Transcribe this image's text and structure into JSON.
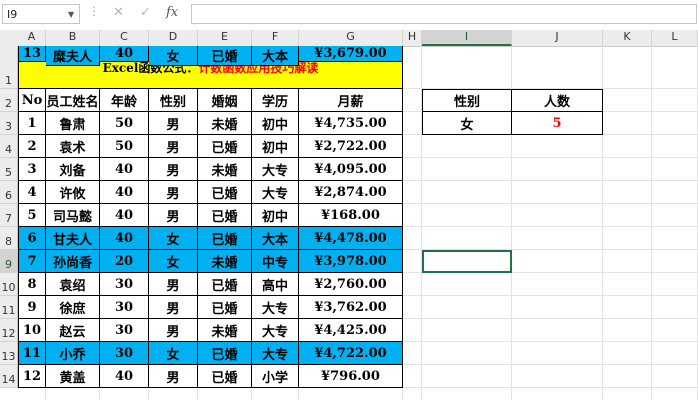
{
  "formula_bar": {
    "name_box": "I9",
    "icons": [
      "close-icon",
      "check-icon",
      "fx-icon"
    ],
    "fx_label": "fx",
    "formula": ""
  },
  "columns": [
    "A",
    "B",
    "C",
    "D",
    "E",
    "F",
    "G",
    "H",
    "I",
    "J",
    "K",
    "L"
  ],
  "rows": [
    "1",
    "2",
    "3",
    "4",
    "5",
    "6",
    "7",
    "8",
    "9",
    "10",
    "11",
    "12",
    "13",
    "14"
  ],
  "selected_cell": {
    "column": "I",
    "row": "9"
  },
  "sheet": {
    "title_part1": "Excel函数公式：",
    "title_part2": "计数函数应用技巧解读",
    "title_color_1": "#000000",
    "title_color_2": "#ff0000",
    "title_fill": "#ffff00",
    "highlight_fill": "#00b0f0",
    "headers": [
      "No",
      "员工姓名",
      "年龄",
      "性别",
      "婚姻",
      "学历",
      "月薪"
    ],
    "records": [
      {
        "no": "1",
        "name": "鲁肃",
        "age": "50",
        "gender": "男",
        "marital": "未婚",
        "edu": "初中",
        "salary": "¥4,735.00",
        "highlight": false
      },
      {
        "no": "2",
        "name": "袁术",
        "age": "50",
        "gender": "男",
        "marital": "已婚",
        "edu": "初中",
        "salary": "¥2,722.00",
        "highlight": false
      },
      {
        "no": "3",
        "name": "刘备",
        "age": "40",
        "gender": "男",
        "marital": "未婚",
        "edu": "大专",
        "salary": "¥4,095.00",
        "highlight": false
      },
      {
        "no": "4",
        "name": "许攸",
        "age": "40",
        "gender": "男",
        "marital": "已婚",
        "edu": "大专",
        "salary": "¥2,874.00",
        "highlight": false
      },
      {
        "no": "5",
        "name": "司马懿",
        "age": "40",
        "gender": "男",
        "marital": "已婚",
        "edu": "初中",
        "salary": "¥168.00",
        "highlight": false
      },
      {
        "no": "6",
        "name": "甘夫人",
        "age": "40",
        "gender": "女",
        "marital": "已婚",
        "edu": "大本",
        "salary": "¥4,478.00",
        "highlight": true
      },
      {
        "no": "7",
        "name": "孙尚香",
        "age": "20",
        "gender": "女",
        "marital": "未婚",
        "edu": "中专",
        "salary": "¥3,978.00",
        "highlight": true
      },
      {
        "no": "8",
        "name": "袁绍",
        "age": "30",
        "gender": "男",
        "marital": "已婚",
        "edu": "高中",
        "salary": "¥2,760.00",
        "highlight": false
      },
      {
        "no": "9",
        "name": "徐庶",
        "age": "30",
        "gender": "男",
        "marital": "已婚",
        "edu": "大专",
        "salary": "¥3,762.00",
        "highlight": false
      },
      {
        "no": "10",
        "name": "赵云",
        "age": "30",
        "gender": "男",
        "marital": "未婚",
        "edu": "大专",
        "salary": "¥4,425.00",
        "highlight": false
      },
      {
        "no": "11",
        "name": "小乔",
        "age": "30",
        "gender": "女",
        "marital": "已婚",
        "edu": "大专",
        "salary": "¥4,722.00",
        "highlight": true
      },
      {
        "no": "12",
        "name": "黄盖",
        "age": "40",
        "gender": "男",
        "marital": "已婚",
        "edu": "小学",
        "salary": "¥796.00",
        "highlight": false
      },
      {
        "no": "13",
        "name": "糜夫人",
        "age": "40",
        "gender": "女",
        "marital": "已婚",
        "edu": "大本",
        "salary": "¥3,679.00",
        "highlight": true
      }
    ],
    "summary": {
      "headers": [
        "性别",
        "人数"
      ],
      "gender": "女",
      "count": "5",
      "count_color": "#ff0000"
    }
  }
}
